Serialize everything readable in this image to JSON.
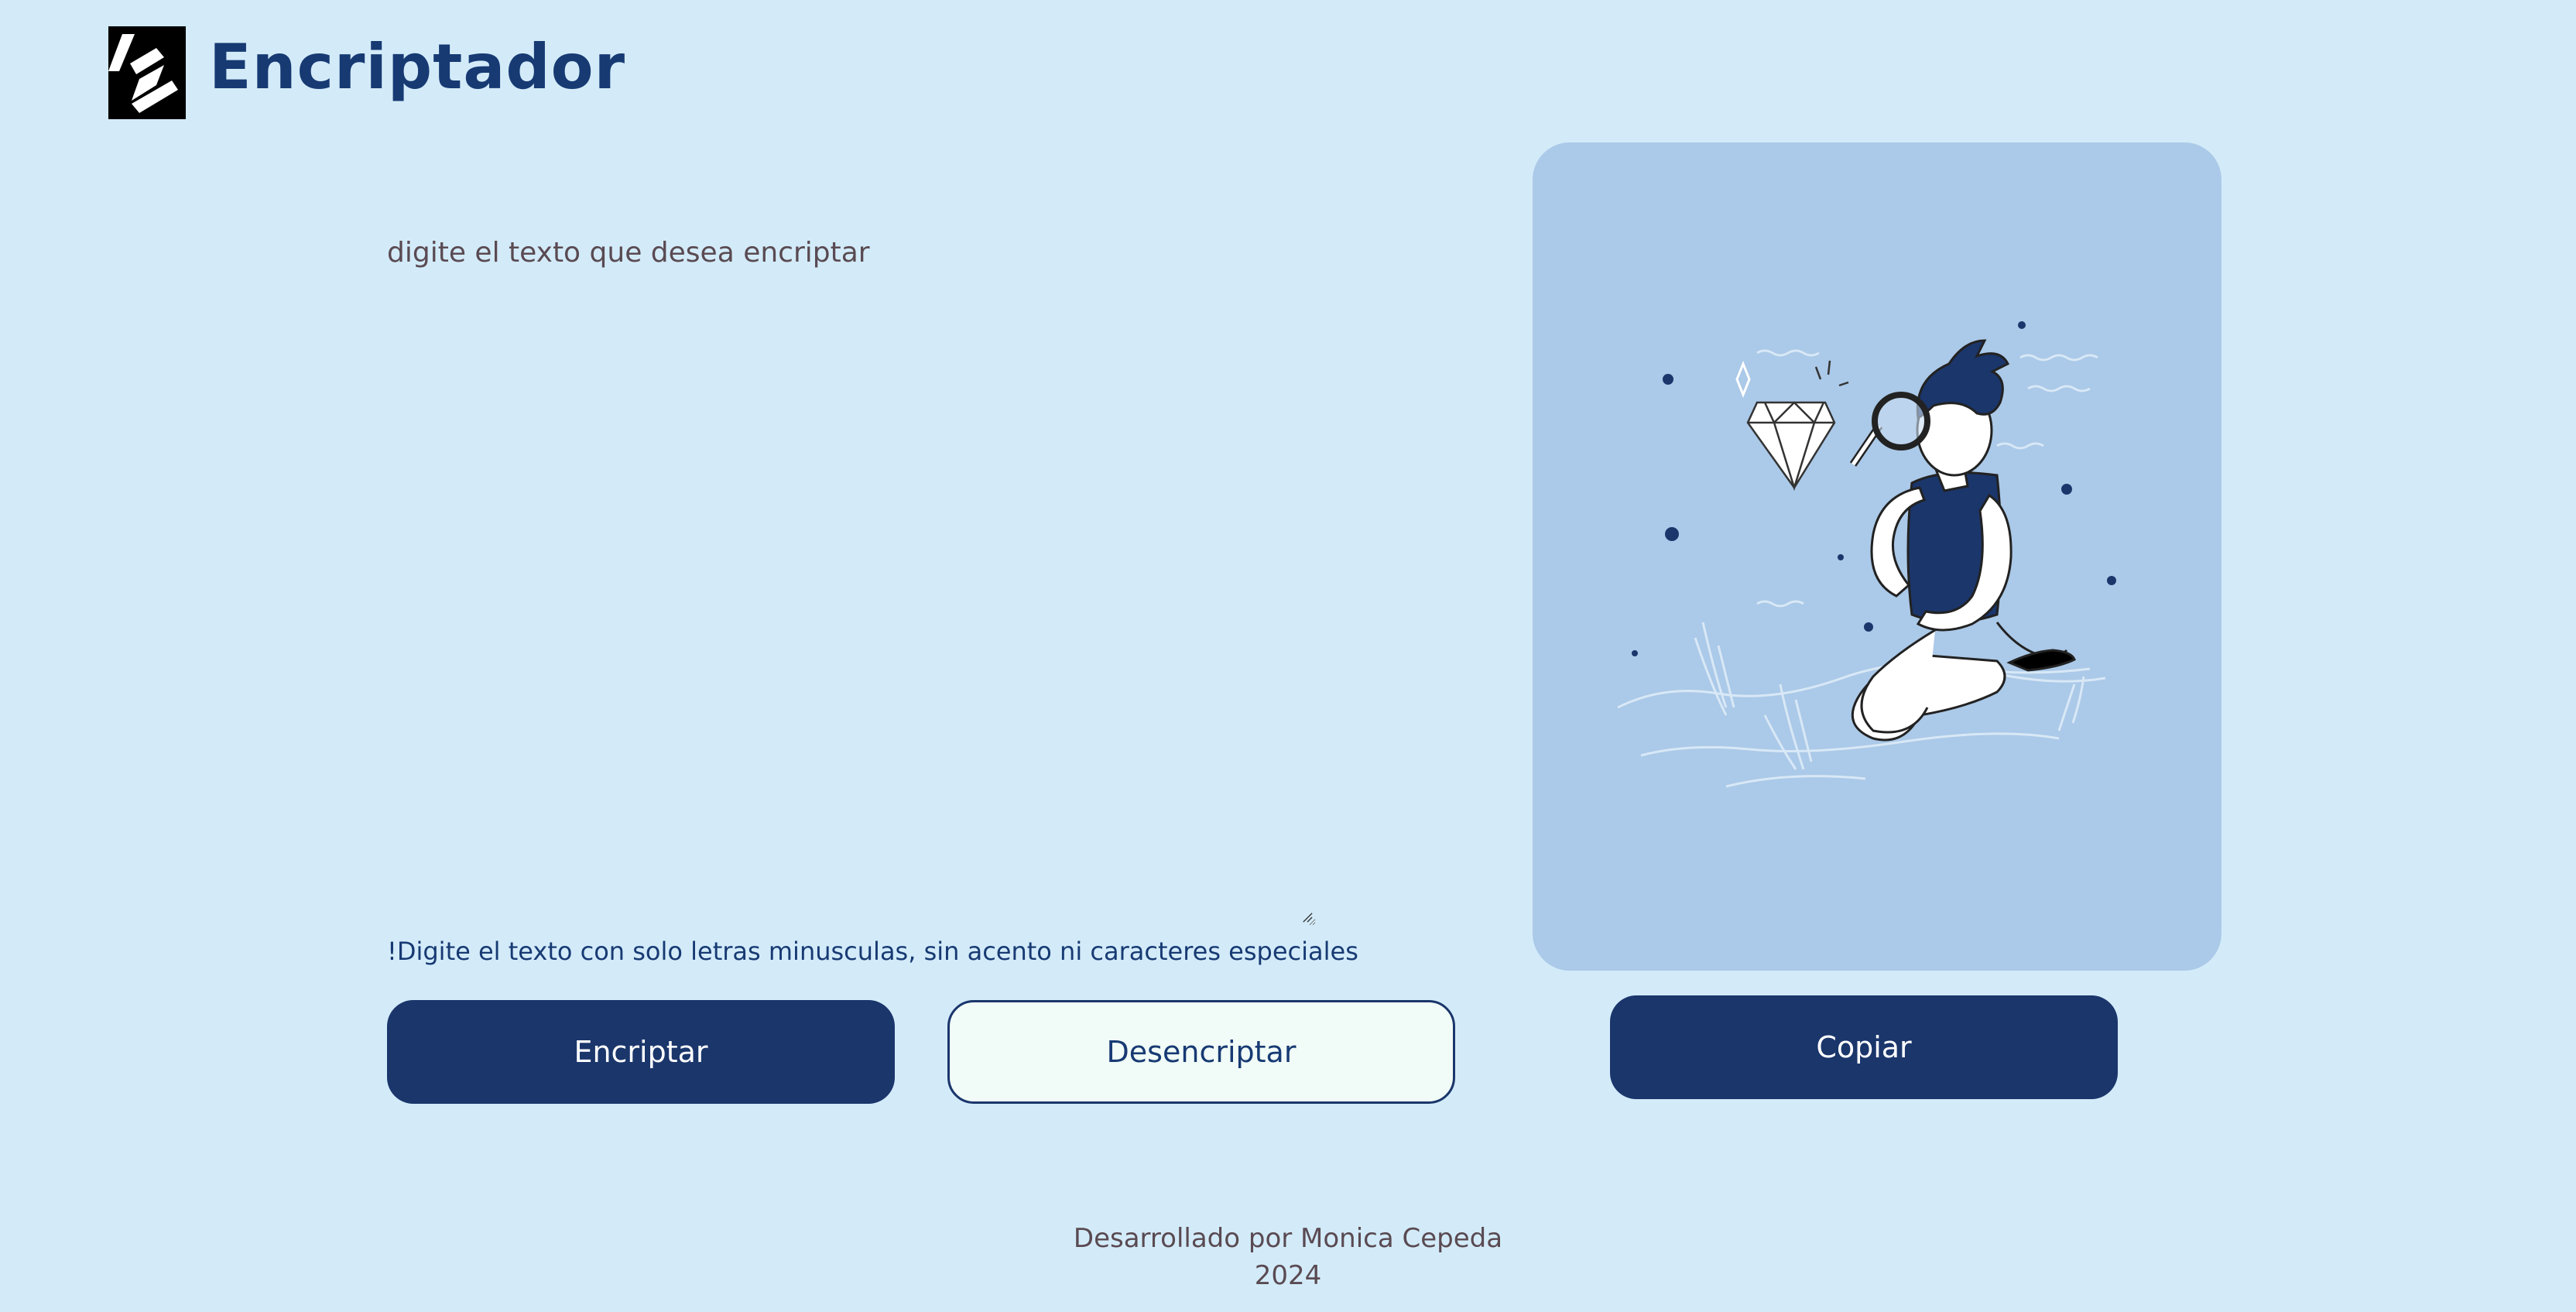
{
  "header": {
    "brand_title": "Encriptador",
    "logo_icon": "logo-icon"
  },
  "input": {
    "placeholder": "digite el texto que desea encriptar",
    "value": ""
  },
  "warning_text": "!Digite el texto con solo letras minusculas, sin acento ni caracteres especiales",
  "buttons": {
    "encrypt_label": "Encriptar",
    "decrypt_label": "Desencriptar",
    "copy_label": "Copiar"
  },
  "output": {
    "illustration": "person-with-magnifying-glass-illustration"
  },
  "footer": {
    "credit": "Desarrollado por Monica Cepeda",
    "year": "2024"
  },
  "colors": {
    "background": "#d3ebf9",
    "primary": "#1a366b",
    "secondary_button_bg": "#f1fbf7",
    "panel": "#abc9e8",
    "title": "#173a73"
  }
}
